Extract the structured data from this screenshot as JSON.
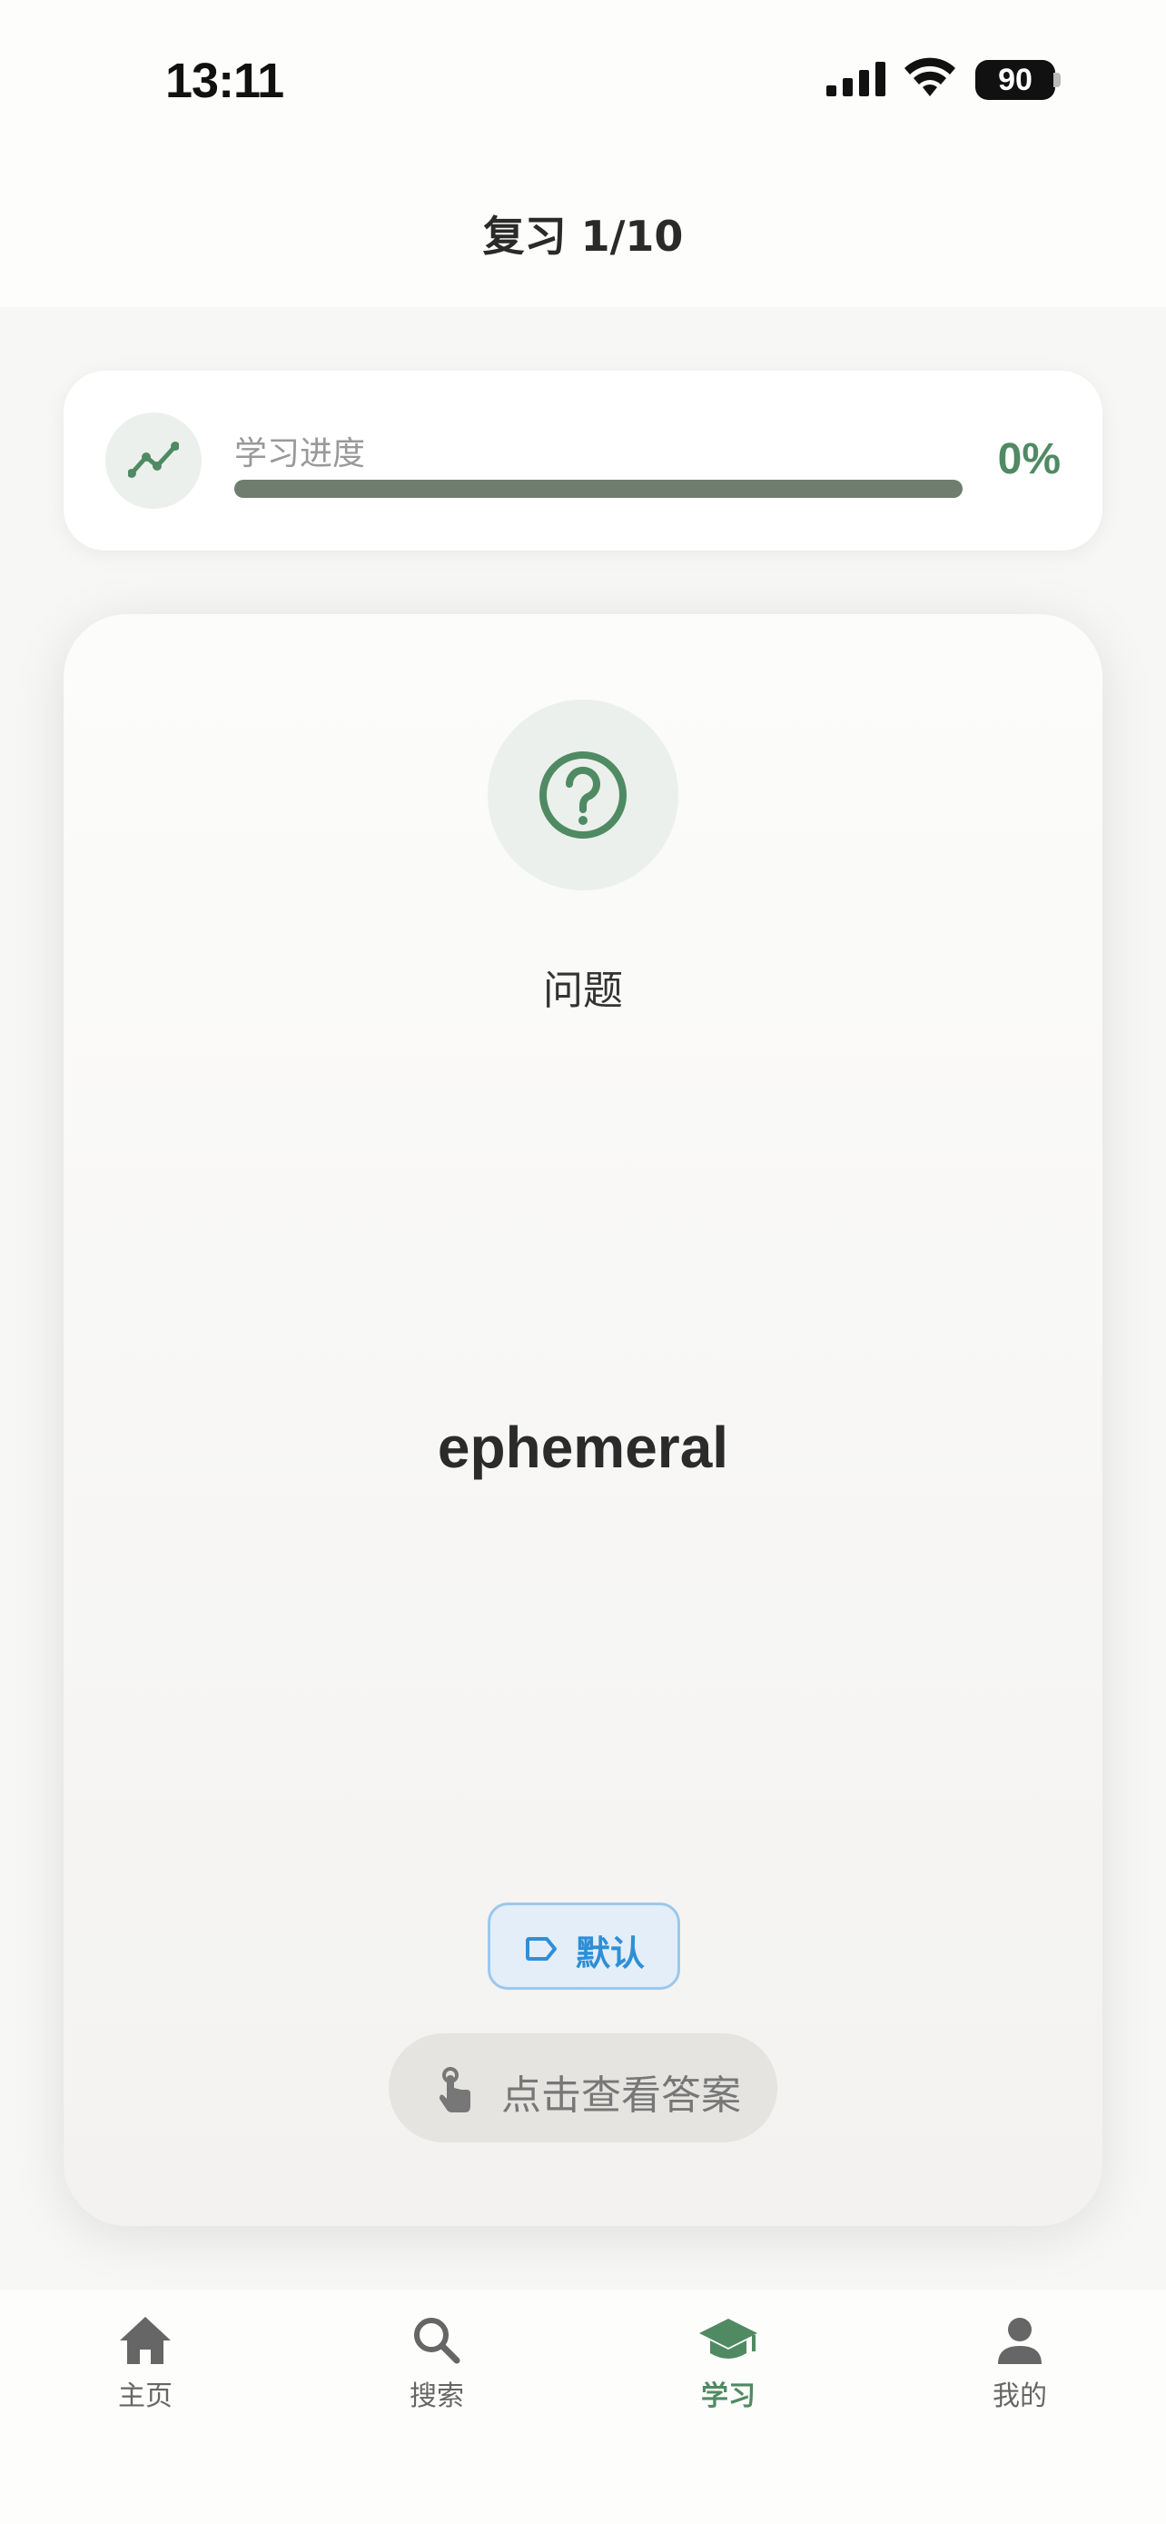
{
  "status_bar": {
    "time": "13:11",
    "battery": "90"
  },
  "header": {
    "title": "复习 1/10"
  },
  "progress": {
    "label": "学习进度",
    "percent_text": "0%",
    "value": 0
  },
  "card": {
    "question_label": "问题",
    "word": "ephemeral",
    "tag_label": "默认",
    "reveal_label": "点击查看答案"
  },
  "tabs": [
    {
      "label": "主页",
      "icon": "home-icon"
    },
    {
      "label": "搜索",
      "icon": "search-icon"
    },
    {
      "label": "学习",
      "icon": "graduation-cap-icon",
      "active": true
    },
    {
      "label": "我的",
      "icon": "person-icon"
    }
  ],
  "colors": {
    "accent": "#4f8a63",
    "tag_blue": "#2f8fd6",
    "inactive": "#666666"
  }
}
